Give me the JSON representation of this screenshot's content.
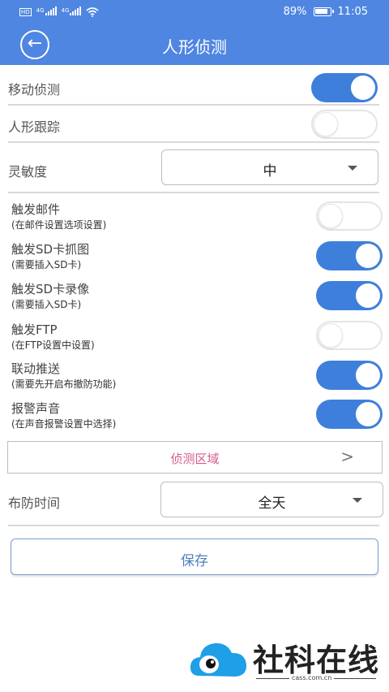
{
  "status_bar": {
    "net1": "4G",
    "net2": "4G",
    "battery": "89%",
    "time": "11:05"
  },
  "header": {
    "title": "人形侦测",
    "back_icon": "back-arrow-circle-icon"
  },
  "settings": {
    "motion_detect": {
      "label": "移动侦测",
      "on": true
    },
    "human_track": {
      "label": "人形跟踪",
      "on": false
    },
    "sensitivity": {
      "label": "灵敏度",
      "value": "中"
    }
  },
  "triggers": [
    {
      "label": "触发邮件",
      "sub": "(在邮件设置选项设置)",
      "on": false
    },
    {
      "label": "触发SD卡抓图",
      "sub": "(需要插入SD卡)",
      "on": true
    },
    {
      "label": "触发SD卡录像",
      "sub": "(需要插入SD卡)",
      "on": true
    },
    {
      "label": "触发FTP",
      "sub": "(在FTP设置中设置)",
      "on": false
    },
    {
      "label": "联动推送",
      "sub": "(需要先开启布撤防功能)",
      "on": true
    },
    {
      "label": "报警声音",
      "sub": "(在声音报警设置中选择)",
      "on": true
    }
  ],
  "detect_area": {
    "label": "侦测区域",
    "chevron": ">"
  },
  "arming_time": {
    "label": "布防时间",
    "value": "全天"
  },
  "save_label": "保存",
  "watermark": {
    "text": "社科在线",
    "url": "cass.com.cn"
  },
  "colors": {
    "accent": "#4f86e2",
    "toggle_on": "#3f7fdc",
    "link_pink": "#d55a8d"
  }
}
